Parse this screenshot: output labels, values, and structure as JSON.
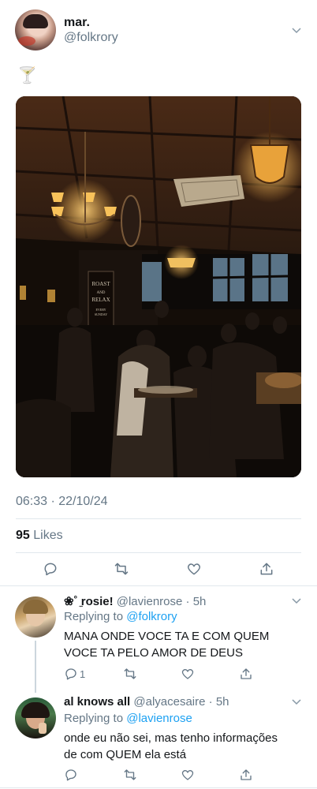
{
  "main_tweet": {
    "display_name": "mar.",
    "handle": "@folkrory",
    "text": "🍸",
    "time": "06:33 · 22/10/24",
    "likes_count": "95",
    "likes_label": "Likes",
    "photo_signage": {
      "line1": "ROAST",
      "line2": "AND",
      "line3": "RELAX",
      "line4": "EVERY",
      "line5": "SUNDAY"
    }
  },
  "replies": [
    {
      "display_name": "❀˚ ̼rosie!",
      "handle": "@lavienrose",
      "age": "· 5h",
      "replying_label": "Replying to",
      "replying_to": "@folkrory",
      "text_line1": "MANA ONDE VOCE TA E COM QUEM",
      "text_line2": "VOCE TA PELO AMOR DE DEUS",
      "reply_count": "1"
    },
    {
      "display_name": "al knows all",
      "handle": "@alyacesaire",
      "age": "· 5h",
      "replying_label": "Replying to",
      "replying_to": "@lavienrose",
      "text_line1": "onde eu não sei, mas tenho informações",
      "text_line2": "de com QUEM ela está",
      "reply_count": ""
    }
  ],
  "colors": {
    "accent": "#1da1f2",
    "muted": "#657786",
    "divider": "#e1e8ed"
  }
}
